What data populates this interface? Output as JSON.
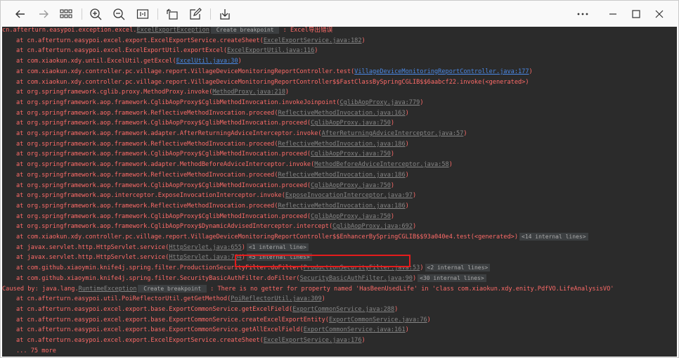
{
  "toolbar": {
    "left": [
      {
        "name": "back-arrow-icon",
        "glyph": "back"
      },
      {
        "name": "forward-arrow-icon",
        "glyph": "forward"
      },
      {
        "name": "grid-view-icon",
        "glyph": "grid"
      },
      {
        "name": "zoom-in-icon",
        "glyph": "zoomin"
      },
      {
        "name": "zoom-out-icon",
        "glyph": "zoomout"
      },
      {
        "name": "fit-page-icon",
        "glyph": "fit"
      },
      {
        "name": "rotate-icon",
        "glyph": "rotate"
      },
      {
        "name": "edit-icon",
        "glyph": "edit"
      },
      {
        "name": "save-icon",
        "glyph": "save"
      }
    ],
    "right": [
      {
        "name": "more-options-icon",
        "glyph": "more"
      },
      {
        "name": "minimize-icon",
        "glyph": "min"
      },
      {
        "name": "maximize-icon",
        "glyph": "max"
      },
      {
        "name": "close-icon",
        "glyph": "close"
      }
    ]
  },
  "console": {
    "lines": [
      {
        "parts": [
          {
            "t": "cn.afterturn.easypoi.exception.excel."
          },
          {
            "t": "ExcelExportException",
            "c": "link"
          },
          {
            "t": " Create breakpoint ",
            "c": "badge"
          },
          {
            "t": " : Excel导出错误"
          }
        ]
      },
      {
        "indent": true,
        "parts": [
          {
            "t": "at cn.afterturn.easypoi.excel.export.ExcelExportService.createSheet("
          },
          {
            "t": "ExcelExportService.java:182",
            "c": "link"
          },
          {
            "t": ")"
          }
        ]
      },
      {
        "indent": true,
        "parts": [
          {
            "t": "at cn.afterturn.easypoi.excel.ExcelExportUtil.exportExcel("
          },
          {
            "t": "ExcelExportUtil.java:116",
            "c": "link"
          },
          {
            "t": ")"
          }
        ]
      },
      {
        "indent": true,
        "parts": [
          {
            "t": "at com.xiaokun.xdy.until.ExcelUtil.getExcel("
          },
          {
            "t": "ExcelUtil.java:30",
            "c": "link blue"
          },
          {
            "t": ")"
          }
        ]
      },
      {
        "indent": true,
        "parts": [
          {
            "t": "at com.xiaokun.xdy.controller.pc.village.report.VillageDeviceMonitoringReportController.test("
          },
          {
            "t": "VillageDeviceMonitoringReportController.java:177",
            "c": "link blue"
          },
          {
            "t": ")"
          }
        ]
      },
      {
        "indent": true,
        "parts": [
          {
            "t": "at com.xiaokun.xdy.controller.pc.village.report.VillageDeviceMonitoringReportController$$FastClassBySpringCGLIB$$6aabcf22.invoke(<generated>)"
          }
        ]
      },
      {
        "indent": true,
        "parts": [
          {
            "t": "at org.springframework.cglib.proxy.MethodProxy.invoke("
          },
          {
            "t": "MethodProxy.java:218",
            "c": "link"
          },
          {
            "t": ")"
          }
        ]
      },
      {
        "indent": true,
        "parts": [
          {
            "t": "at org.springframework.aop.framework.CglibAopProxy$CglibMethodInvocation.invokeJoinpoint("
          },
          {
            "t": "CglibAopProxy.java:779",
            "c": "link"
          },
          {
            "t": ")"
          }
        ]
      },
      {
        "indent": true,
        "parts": [
          {
            "t": "at org.springframework.aop.framework.ReflectiveMethodInvocation.proceed("
          },
          {
            "t": "ReflectiveMethodInvocation.java:163",
            "c": "link"
          },
          {
            "t": ")"
          }
        ]
      },
      {
        "indent": true,
        "parts": [
          {
            "t": "at org.springframework.aop.framework.CglibAopProxy$CglibMethodInvocation.proceed("
          },
          {
            "t": "CglibAopProxy.java:750",
            "c": "link"
          },
          {
            "t": ")"
          }
        ]
      },
      {
        "indent": true,
        "parts": [
          {
            "t": "at org.springframework.aop.framework.adapter.AfterReturningAdviceInterceptor.invoke("
          },
          {
            "t": "AfterReturningAdviceInterceptor.java:57",
            "c": "link"
          },
          {
            "t": ")"
          }
        ]
      },
      {
        "indent": true,
        "parts": [
          {
            "t": "at org.springframework.aop.framework.ReflectiveMethodInvocation.proceed("
          },
          {
            "t": "ReflectiveMethodInvocation.java:186",
            "c": "link"
          },
          {
            "t": ")"
          }
        ]
      },
      {
        "indent": true,
        "parts": [
          {
            "t": "at org.springframework.aop.framework.CglibAopProxy$CglibMethodInvocation.proceed("
          },
          {
            "t": "CglibAopProxy.java:750",
            "c": "link"
          },
          {
            "t": ")"
          }
        ]
      },
      {
        "indent": true,
        "parts": [
          {
            "t": "at org.springframework.aop.framework.adapter.MethodBeforeAdviceInterceptor.invoke("
          },
          {
            "t": "MethodBeforeAdviceInterceptor.java:58",
            "c": "link"
          },
          {
            "t": ")"
          }
        ]
      },
      {
        "indent": true,
        "parts": [
          {
            "t": "at org.springframework.aop.framework.ReflectiveMethodInvocation.proceed("
          },
          {
            "t": "ReflectiveMethodInvocation.java:186",
            "c": "link"
          },
          {
            "t": ")"
          }
        ]
      },
      {
        "indent": true,
        "parts": [
          {
            "t": "at org.springframework.aop.framework.CglibAopProxy$CglibMethodInvocation.proceed("
          },
          {
            "t": "CglibAopProxy.java:750",
            "c": "link"
          },
          {
            "t": ")"
          }
        ]
      },
      {
        "indent": true,
        "parts": [
          {
            "t": "at org.springframework.aop.interceptor.ExposeInvocationInterceptor.invoke("
          },
          {
            "t": "ExposeInvocationInterceptor.java:97",
            "c": "link"
          },
          {
            "t": ")"
          }
        ]
      },
      {
        "indent": true,
        "parts": [
          {
            "t": "at org.springframework.aop.framework.ReflectiveMethodInvocation.proceed("
          },
          {
            "t": "ReflectiveMethodInvocation.java:186",
            "c": "link"
          },
          {
            "t": ")"
          }
        ]
      },
      {
        "indent": true,
        "parts": [
          {
            "t": "at org.springframework.aop.framework.CglibAopProxy$CglibMethodInvocation.proceed("
          },
          {
            "t": "CglibAopProxy.java:750",
            "c": "link"
          },
          {
            "t": ")"
          }
        ]
      },
      {
        "indent": true,
        "parts": [
          {
            "t": "at org.springframework.aop.framework.CglibAopProxy$DynamicAdvisedInterceptor.intercept("
          },
          {
            "t": "CglibAopProxy.java:692",
            "c": "link"
          },
          {
            "t": ")"
          }
        ]
      },
      {
        "indent": true,
        "parts": [
          {
            "t": "at com.xiaokun.xdy.controller.pc.village.report.VillageDeviceMonitoringReportController$$EnhancerBySpringCGLIB$$93a040e4.test(<generated>)"
          },
          {
            "t": "<14 internal lines>",
            "c": "badge"
          }
        ]
      },
      {
        "indent": true,
        "parts": [
          {
            "t": "at javax.servlet.http.HttpServlet.service("
          },
          {
            "t": "HttpServlet.java:655",
            "c": "link"
          },
          {
            "t": ")"
          },
          {
            "t": "<1 internal line>",
            "c": "badge"
          }
        ]
      },
      {
        "indent": true,
        "parts": [
          {
            "t": "at javax.servlet.http.HttpServlet.service("
          },
          {
            "t": "HttpServlet.java:764",
            "c": "link"
          },
          {
            "t": ")"
          },
          {
            "t": "<5 internal lines>",
            "c": "badge"
          }
        ]
      },
      {
        "indent": true,
        "parts": [
          {
            "t": "at com.github.xiaoymin.knife4j.spring.filter.ProductionSecurityFilter.doFilter("
          },
          {
            "t": "ProductionSecurityFilter.java:53",
            "c": "link"
          },
          {
            "t": ")"
          },
          {
            "t": "<2 internal lines>",
            "c": "badge"
          }
        ]
      },
      {
        "indent": true,
        "parts": [
          {
            "t": "at com.github.xiaoymin.knife4j.spring.filter.SecurityBasicAuthFilter.doFilter("
          },
          {
            "t": "SecurityBasicAuthFilter.java:90",
            "c": "link"
          },
          {
            "t": ")"
          },
          {
            "t": "<30 internal lines>",
            "c": "badge"
          }
        ]
      },
      {
        "parts": [
          {
            "t": "Caused by: java.lang."
          },
          {
            "t": "RuntimeException",
            "c": "link"
          },
          {
            "t": " Create breakpoint ",
            "c": "badge"
          },
          {
            "t": " : There is no getter for property named 'HasBeenUsedLife' in 'class com.xiaokun.xdy.enity.PdfVO.LifeAnalysisVO'"
          }
        ]
      },
      {
        "indent": true,
        "parts": [
          {
            "t": "at cn.afterturn.easypoi.util.PoiReflectorUtil.getGetMethod("
          },
          {
            "t": "PoiReflectorUtil.java:309",
            "c": "link"
          },
          {
            "t": ")"
          }
        ]
      },
      {
        "indent": true,
        "parts": [
          {
            "t": "at cn.afterturn.easypoi.excel.export.base.ExportCommonService.getExcelField("
          },
          {
            "t": "ExportCommonService.java:288",
            "c": "link"
          },
          {
            "t": ")"
          }
        ]
      },
      {
        "indent": true,
        "parts": [
          {
            "t": "at cn.afterturn.easypoi.excel.export.base.ExportCommonService.createExcelExportEntity("
          },
          {
            "t": "ExportCommonService.java:76",
            "c": "link"
          },
          {
            "t": ")"
          }
        ]
      },
      {
        "indent": true,
        "parts": [
          {
            "t": "at cn.afterturn.easypoi.excel.export.base.ExportCommonService.getAllExcelField("
          },
          {
            "t": "ExportCommonService.java:161",
            "c": "link"
          },
          {
            "t": ")"
          }
        ]
      },
      {
        "indent": true,
        "parts": [
          {
            "t": "at cn.afterturn.easypoi.excel.export.ExcelExportService.createSheet("
          },
          {
            "t": "ExcelExportService.java:176",
            "c": "link"
          },
          {
            "t": ")"
          }
        ]
      },
      {
        "indent": true,
        "parts": [
          {
            "t": "... 75 more"
          }
        ]
      }
    ]
  },
  "highlight": {
    "target": "no getter for property named 'HasBeenUsedLife'",
    "color": "#e51c1c"
  }
}
